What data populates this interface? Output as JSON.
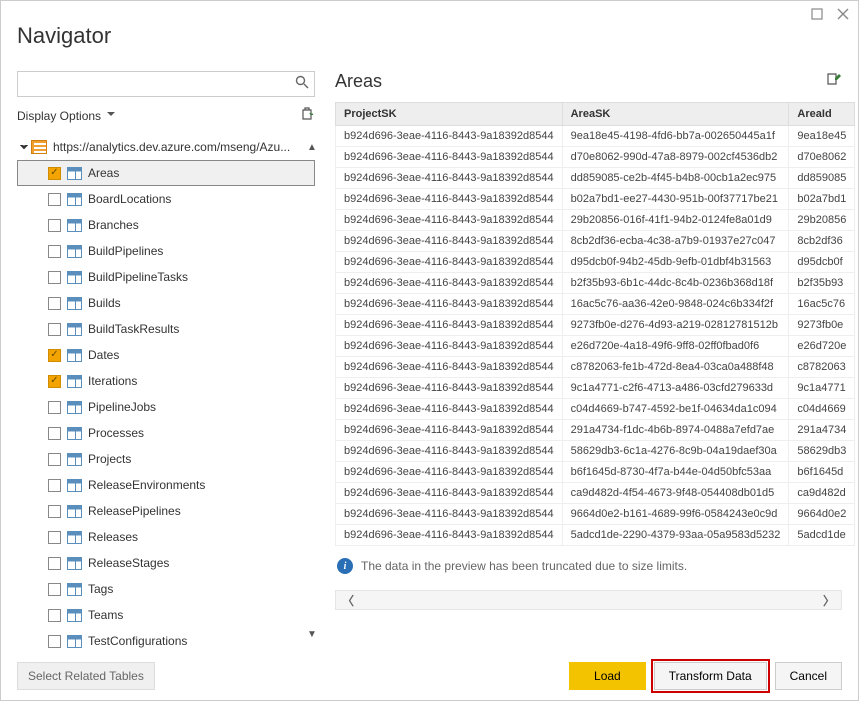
{
  "window": {
    "title": "Navigator"
  },
  "left": {
    "search_placeholder": "",
    "display_options_label": "Display Options",
    "select_related_label": "Select Related Tables",
    "source_label": "https://analytics.dev.azure.com/mseng/Azu...",
    "items": [
      {
        "label": "Areas",
        "checked": true,
        "selected": true
      },
      {
        "label": "BoardLocations",
        "checked": false,
        "selected": false
      },
      {
        "label": "Branches",
        "checked": false,
        "selected": false
      },
      {
        "label": "BuildPipelines",
        "checked": false,
        "selected": false
      },
      {
        "label": "BuildPipelineTasks",
        "checked": false,
        "selected": false
      },
      {
        "label": "Builds",
        "checked": false,
        "selected": false
      },
      {
        "label": "BuildTaskResults",
        "checked": false,
        "selected": false
      },
      {
        "label": "Dates",
        "checked": true,
        "selected": false
      },
      {
        "label": "Iterations",
        "checked": true,
        "selected": false
      },
      {
        "label": "PipelineJobs",
        "checked": false,
        "selected": false
      },
      {
        "label": "Processes",
        "checked": false,
        "selected": false
      },
      {
        "label": "Projects",
        "checked": false,
        "selected": false
      },
      {
        "label": "ReleaseEnvironments",
        "checked": false,
        "selected": false
      },
      {
        "label": "ReleasePipelines",
        "checked": false,
        "selected": false
      },
      {
        "label": "Releases",
        "checked": false,
        "selected": false
      },
      {
        "label": "ReleaseStages",
        "checked": false,
        "selected": false
      },
      {
        "label": "Tags",
        "checked": false,
        "selected": false
      },
      {
        "label": "Teams",
        "checked": false,
        "selected": false
      },
      {
        "label": "TestConfigurations",
        "checked": false,
        "selected": false
      }
    ]
  },
  "preview": {
    "title": "Areas",
    "columns": [
      "ProjectSK",
      "AreaSK",
      "AreaId"
    ],
    "rows": [
      [
        "b924d696-3eae-4116-8443-9a18392d8544",
        "9ea18e45-4198-4fd6-bb7a-002650445a1f",
        "9ea18e45"
      ],
      [
        "b924d696-3eae-4116-8443-9a18392d8544",
        "d70e8062-990d-47a8-8979-002cf4536db2",
        "d70e8062"
      ],
      [
        "b924d696-3eae-4116-8443-9a18392d8544",
        "dd859085-ce2b-4f45-b4b8-00cb1a2ec975",
        "dd859085"
      ],
      [
        "b924d696-3eae-4116-8443-9a18392d8544",
        "b02a7bd1-ee27-4430-951b-00f37717be21",
        "b02a7bd1"
      ],
      [
        "b924d696-3eae-4116-8443-9a18392d8544",
        "29b20856-016f-41f1-94b2-0124fe8a01d9",
        "29b20856"
      ],
      [
        "b924d696-3eae-4116-8443-9a18392d8544",
        "8cb2df36-ecba-4c38-a7b9-01937e27c047",
        "8cb2df36"
      ],
      [
        "b924d696-3eae-4116-8443-9a18392d8544",
        "d95dcb0f-94b2-45db-9efb-01dbf4b31563",
        "d95dcb0f"
      ],
      [
        "b924d696-3eae-4116-8443-9a18392d8544",
        "b2f35b93-6b1c-44dc-8c4b-0236b368d18f",
        "b2f35b93"
      ],
      [
        "b924d696-3eae-4116-8443-9a18392d8544",
        "16ac5c76-aa36-42e0-9848-024c6b334f2f",
        "16ac5c76"
      ],
      [
        "b924d696-3eae-4116-8443-9a18392d8544",
        "9273fb0e-d276-4d93-a219-02812781512b",
        "9273fb0e"
      ],
      [
        "b924d696-3eae-4116-8443-9a18392d8544",
        "e26d720e-4a18-49f6-9ff8-02ff0fbad0f6",
        "e26d720e"
      ],
      [
        "b924d696-3eae-4116-8443-9a18392d8544",
        "c8782063-fe1b-472d-8ea4-03ca0a488f48",
        "c8782063"
      ],
      [
        "b924d696-3eae-4116-8443-9a18392d8544",
        "9c1a4771-c2f6-4713-a486-03cfd279633d",
        "9c1a4771"
      ],
      [
        "b924d696-3eae-4116-8443-9a18392d8544",
        "c04d4669-b747-4592-be1f-04634da1c094",
        "c04d4669"
      ],
      [
        "b924d696-3eae-4116-8443-9a18392d8544",
        "291a4734-f1dc-4b6b-8974-0488a7efd7ae",
        "291a4734"
      ],
      [
        "b924d696-3eae-4116-8443-9a18392d8544",
        "58629db3-6c1a-4276-8c9b-04a19daef30a",
        "58629db3"
      ],
      [
        "b924d696-3eae-4116-8443-9a18392d8544",
        "b6f1645d-8730-4f7a-b44e-04d50bfc53aa",
        "b6f1645d"
      ],
      [
        "b924d696-3eae-4116-8443-9a18392d8544",
        "ca9d482d-4f54-4673-9f48-054408db01d5",
        "ca9d482d"
      ],
      [
        "b924d696-3eae-4116-8443-9a18392d8544",
        "9664d0e2-b161-4689-99f6-0584243e0c9d",
        "9664d0e2"
      ],
      [
        "b924d696-3eae-4116-8443-9a18392d8544",
        "5adcd1de-2290-4379-93aa-05a9583d5232",
        "5adcd1de"
      ]
    ],
    "notice": "The data in the preview has been truncated due to size limits."
  },
  "buttons": {
    "load": "Load",
    "transform": "Transform Data",
    "cancel": "Cancel"
  }
}
